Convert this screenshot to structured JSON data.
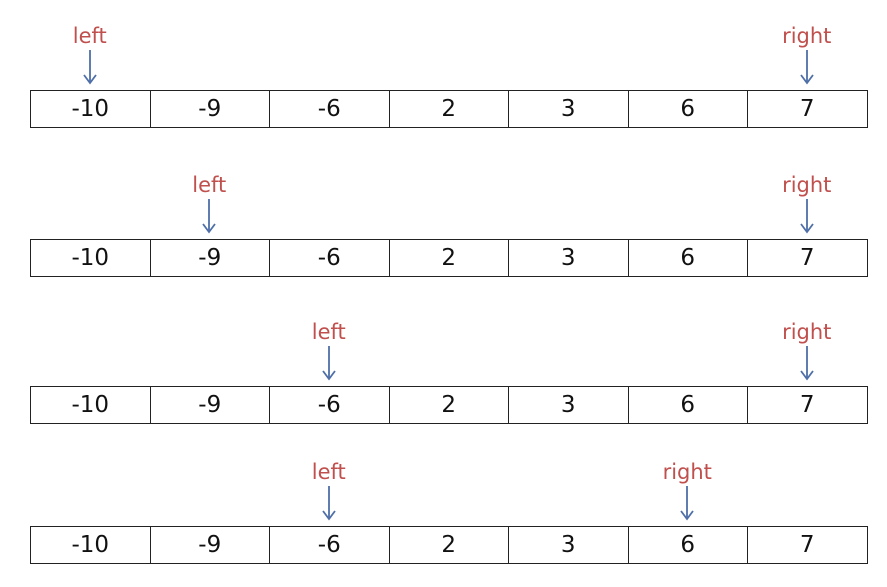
{
  "array": [
    "-10",
    "-9",
    "-6",
    "2",
    "3",
    "6",
    "7"
  ],
  "pointer_labels": {
    "left": "left",
    "right": "right"
  },
  "steps": [
    {
      "left_index": 0,
      "right_index": 6
    },
    {
      "left_index": 1,
      "right_index": 6
    },
    {
      "left_index": 2,
      "right_index": 6
    },
    {
      "left_index": 2,
      "right_index": 5
    }
  ],
  "colors": {
    "label": "#c0504d",
    "arrow": "#4f6fa8",
    "border": "#222222"
  }
}
